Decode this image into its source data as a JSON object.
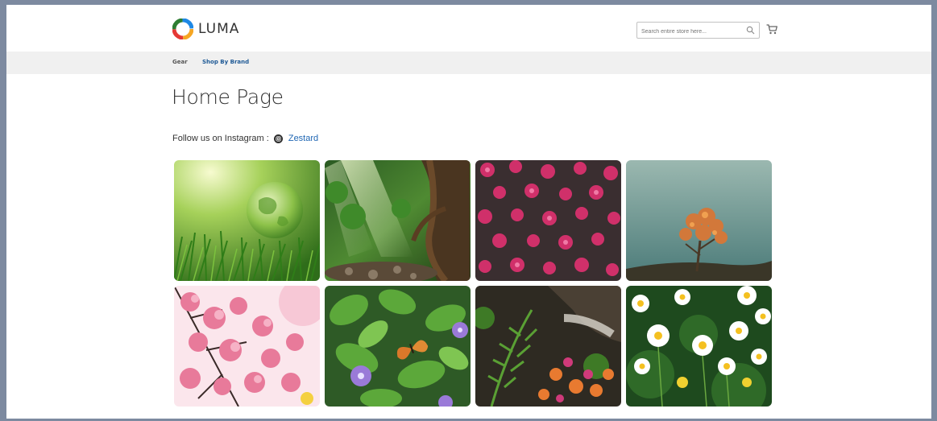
{
  "header": {
    "logo_text": "LUMA",
    "search_placeholder": "Search entire store here...",
    "icons": [
      "luma-logo-icon",
      "search-icon",
      "cart-icon"
    ]
  },
  "nav": {
    "items": [
      {
        "label": "Gear"
      },
      {
        "label": "Shop By Brand"
      }
    ]
  },
  "main": {
    "page_title": "Home Page",
    "follow_label": "Follow us on Instagram :",
    "instagram_account": "Zestard"
  },
  "gallery": {
    "photos": [
      {
        "subject": "glass-globe-in-grass"
      },
      {
        "subject": "forest-with-sunbeams"
      },
      {
        "subject": "pink-blossom-clusters"
      },
      {
        "subject": "orange-tree-teal-sky"
      },
      {
        "subject": "pink-cherry-blossoms"
      },
      {
        "subject": "butterfly-on-leaves"
      },
      {
        "subject": "fern-and-flowers"
      },
      {
        "subject": "white-daisies"
      }
    ]
  },
  "colors": {
    "link": "#1f66b3",
    "nav_active": "#1f5a96",
    "nav_bg": "#f0f0f0",
    "frame": "#7d8aa0"
  }
}
